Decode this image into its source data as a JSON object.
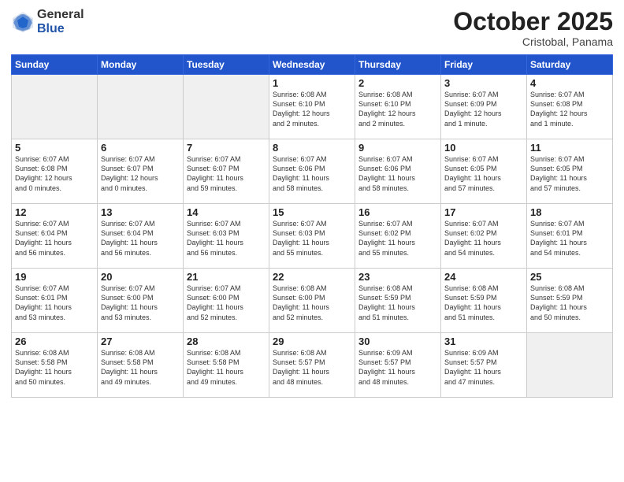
{
  "logo": {
    "general": "General",
    "blue": "Blue"
  },
  "header": {
    "month": "October 2025",
    "location": "Cristobal, Panama"
  },
  "weekdays": [
    "Sunday",
    "Monday",
    "Tuesday",
    "Wednesday",
    "Thursday",
    "Friday",
    "Saturday"
  ],
  "weeks": [
    [
      {
        "day": "",
        "info": ""
      },
      {
        "day": "",
        "info": ""
      },
      {
        "day": "",
        "info": ""
      },
      {
        "day": "1",
        "info": "Sunrise: 6:08 AM\nSunset: 6:10 PM\nDaylight: 12 hours\nand 2 minutes."
      },
      {
        "day": "2",
        "info": "Sunrise: 6:08 AM\nSunset: 6:10 PM\nDaylight: 12 hours\nand 2 minutes."
      },
      {
        "day": "3",
        "info": "Sunrise: 6:07 AM\nSunset: 6:09 PM\nDaylight: 12 hours\nand 1 minute."
      },
      {
        "day": "4",
        "info": "Sunrise: 6:07 AM\nSunset: 6:08 PM\nDaylight: 12 hours\nand 1 minute."
      }
    ],
    [
      {
        "day": "5",
        "info": "Sunrise: 6:07 AM\nSunset: 6:08 PM\nDaylight: 12 hours\nand 0 minutes."
      },
      {
        "day": "6",
        "info": "Sunrise: 6:07 AM\nSunset: 6:07 PM\nDaylight: 12 hours\nand 0 minutes."
      },
      {
        "day": "7",
        "info": "Sunrise: 6:07 AM\nSunset: 6:07 PM\nDaylight: 11 hours\nand 59 minutes."
      },
      {
        "day": "8",
        "info": "Sunrise: 6:07 AM\nSunset: 6:06 PM\nDaylight: 11 hours\nand 58 minutes."
      },
      {
        "day": "9",
        "info": "Sunrise: 6:07 AM\nSunset: 6:06 PM\nDaylight: 11 hours\nand 58 minutes."
      },
      {
        "day": "10",
        "info": "Sunrise: 6:07 AM\nSunset: 6:05 PM\nDaylight: 11 hours\nand 57 minutes."
      },
      {
        "day": "11",
        "info": "Sunrise: 6:07 AM\nSunset: 6:05 PM\nDaylight: 11 hours\nand 57 minutes."
      }
    ],
    [
      {
        "day": "12",
        "info": "Sunrise: 6:07 AM\nSunset: 6:04 PM\nDaylight: 11 hours\nand 56 minutes."
      },
      {
        "day": "13",
        "info": "Sunrise: 6:07 AM\nSunset: 6:04 PM\nDaylight: 11 hours\nand 56 minutes."
      },
      {
        "day": "14",
        "info": "Sunrise: 6:07 AM\nSunset: 6:03 PM\nDaylight: 11 hours\nand 56 minutes."
      },
      {
        "day": "15",
        "info": "Sunrise: 6:07 AM\nSunset: 6:03 PM\nDaylight: 11 hours\nand 55 minutes."
      },
      {
        "day": "16",
        "info": "Sunrise: 6:07 AM\nSunset: 6:02 PM\nDaylight: 11 hours\nand 55 minutes."
      },
      {
        "day": "17",
        "info": "Sunrise: 6:07 AM\nSunset: 6:02 PM\nDaylight: 11 hours\nand 54 minutes."
      },
      {
        "day": "18",
        "info": "Sunrise: 6:07 AM\nSunset: 6:01 PM\nDaylight: 11 hours\nand 54 minutes."
      }
    ],
    [
      {
        "day": "19",
        "info": "Sunrise: 6:07 AM\nSunset: 6:01 PM\nDaylight: 11 hours\nand 53 minutes."
      },
      {
        "day": "20",
        "info": "Sunrise: 6:07 AM\nSunset: 6:00 PM\nDaylight: 11 hours\nand 53 minutes."
      },
      {
        "day": "21",
        "info": "Sunrise: 6:07 AM\nSunset: 6:00 PM\nDaylight: 11 hours\nand 52 minutes."
      },
      {
        "day": "22",
        "info": "Sunrise: 6:08 AM\nSunset: 6:00 PM\nDaylight: 11 hours\nand 52 minutes."
      },
      {
        "day": "23",
        "info": "Sunrise: 6:08 AM\nSunset: 5:59 PM\nDaylight: 11 hours\nand 51 minutes."
      },
      {
        "day": "24",
        "info": "Sunrise: 6:08 AM\nSunset: 5:59 PM\nDaylight: 11 hours\nand 51 minutes."
      },
      {
        "day": "25",
        "info": "Sunrise: 6:08 AM\nSunset: 5:59 PM\nDaylight: 11 hours\nand 50 minutes."
      }
    ],
    [
      {
        "day": "26",
        "info": "Sunrise: 6:08 AM\nSunset: 5:58 PM\nDaylight: 11 hours\nand 50 minutes."
      },
      {
        "day": "27",
        "info": "Sunrise: 6:08 AM\nSunset: 5:58 PM\nDaylight: 11 hours\nand 49 minutes."
      },
      {
        "day": "28",
        "info": "Sunrise: 6:08 AM\nSunset: 5:58 PM\nDaylight: 11 hours\nand 49 minutes."
      },
      {
        "day": "29",
        "info": "Sunrise: 6:08 AM\nSunset: 5:57 PM\nDaylight: 11 hours\nand 48 minutes."
      },
      {
        "day": "30",
        "info": "Sunrise: 6:09 AM\nSunset: 5:57 PM\nDaylight: 11 hours\nand 48 minutes."
      },
      {
        "day": "31",
        "info": "Sunrise: 6:09 AM\nSunset: 5:57 PM\nDaylight: 11 hours\nand 47 minutes."
      },
      {
        "day": "",
        "info": ""
      }
    ]
  ]
}
